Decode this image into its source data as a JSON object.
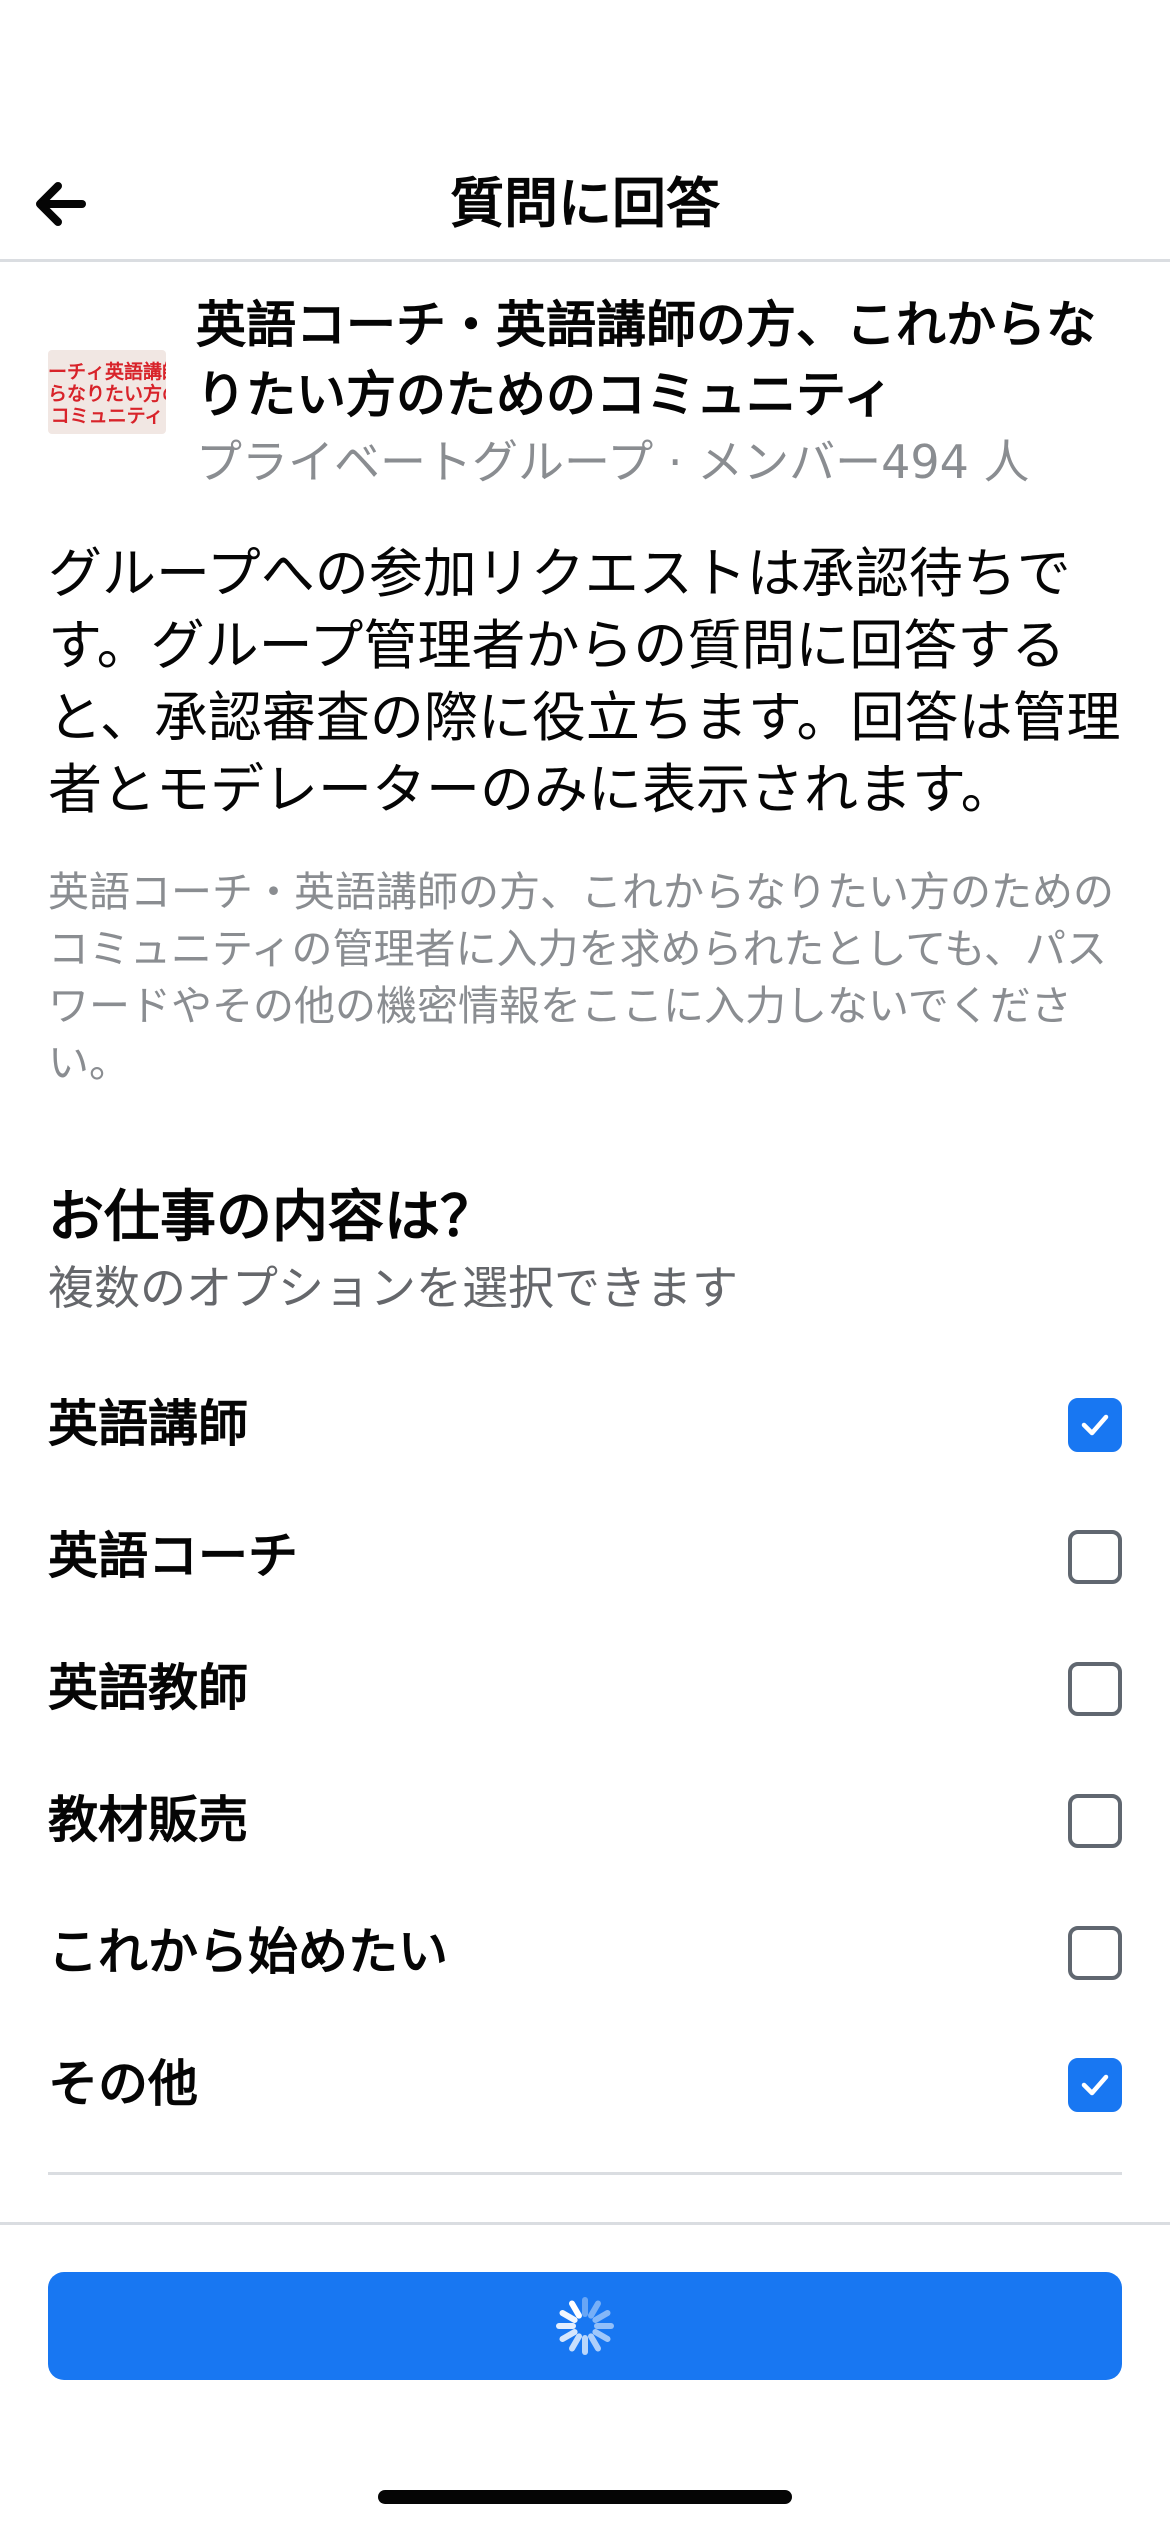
{
  "nav": {
    "title": "質問に回答",
    "back_icon": "arrow-left-icon"
  },
  "group": {
    "name": "英語コーチ・英語講師の方、これからなりたい方のためのコミュニティ",
    "meta": "プライベートグループ · メンバー494 人",
    "thumbnail_text": [
      "ーチィ英語講師",
      "らなりたい方の",
      "コミュニティ"
    ]
  },
  "intro": "グループへの参加リクエストは承認待ちです。グループ管理者からの質問に回答すると、承認審査の際に役立ちます。回答は管理者とモデレーターのみに表示されます。",
  "warning": "英語コーチ・英語講師の方、これからなりたい方のためのコミュニティの管理者に入力を求められたとしても、パスワードやその他の機密情報をここに入力しないでください。",
  "question": {
    "title": "お仕事の内容は？",
    "subtitle": "複数のオプションを選択できます",
    "options": [
      {
        "label": "英語講師",
        "checked": true
      },
      {
        "label": "英語コーチ",
        "checked": false
      },
      {
        "label": "英語教師",
        "checked": false
      },
      {
        "label": "教材販売",
        "checked": false
      },
      {
        "label": "これから始めたい",
        "checked": false
      },
      {
        "label": "その他",
        "checked": true
      }
    ]
  },
  "submit": {
    "state": "loading",
    "icon": "spinner-icon"
  },
  "colors": {
    "accent": "#1877f2",
    "text_primary": "#050505",
    "text_secondary": "#8a8d91",
    "divider": "#dadde1"
  }
}
